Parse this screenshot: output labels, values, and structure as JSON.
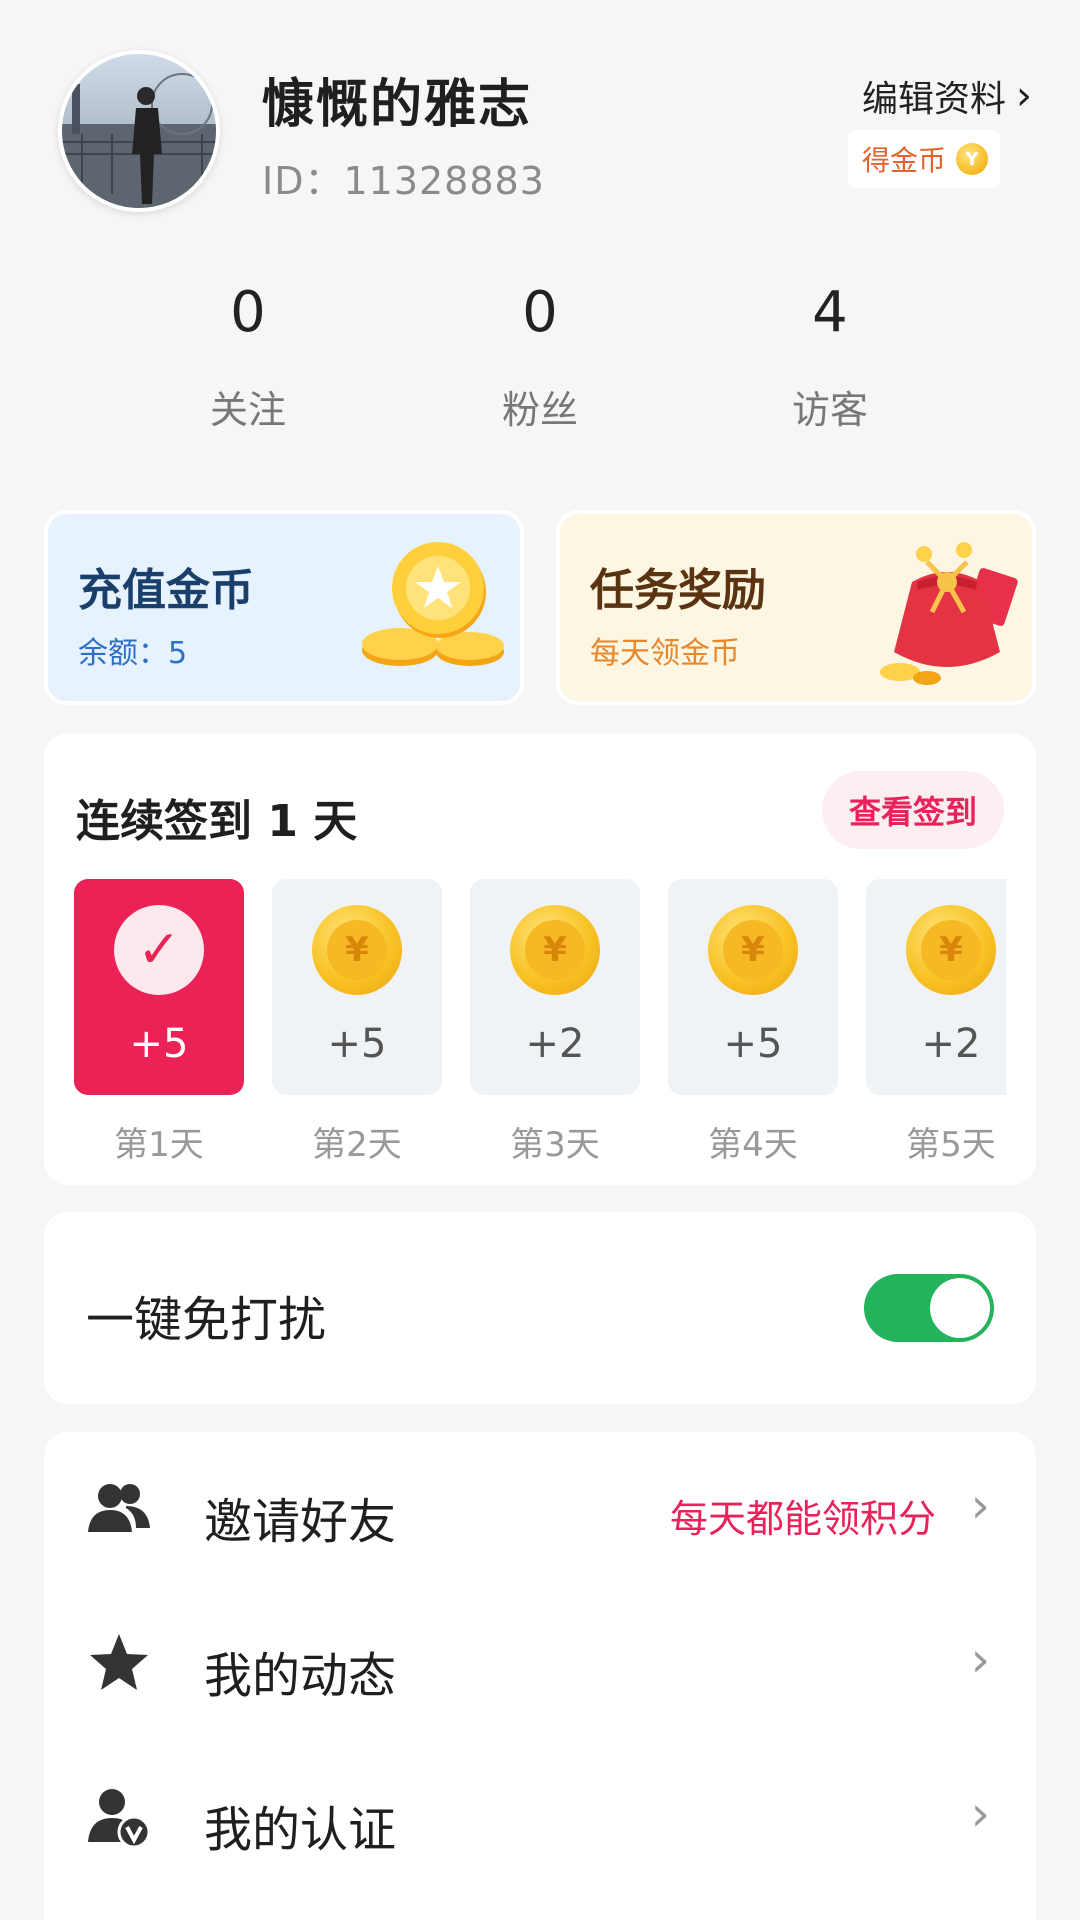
{
  "profile": {
    "name": "慷慨的雅志",
    "id_text": "ID：11328883",
    "edit_label": "编辑资料",
    "coin_badge_label": "得金币",
    "coin_symbol": "Y"
  },
  "stats": [
    {
      "value": "0",
      "label": "关注"
    },
    {
      "value": "0",
      "label": "粉丝"
    },
    {
      "value": "4",
      "label": "访客"
    }
  ],
  "cards": {
    "recharge": {
      "title": "充值金币",
      "subtitle": "余额：5"
    },
    "task": {
      "title": "任务奖励",
      "subtitle": "每天领金币"
    }
  },
  "signin": {
    "title": "连续签到 1 天",
    "button": "查看签到",
    "coin_symbol": "¥",
    "check_symbol": "✓",
    "days": [
      {
        "reward": "+5",
        "label": "第1天",
        "checked": true
      },
      {
        "reward": "+5",
        "label": "第2天",
        "checked": false
      },
      {
        "reward": "+2",
        "label": "第3天",
        "checked": false
      },
      {
        "reward": "+5",
        "label": "第4天",
        "checked": false
      },
      {
        "reward": "+2",
        "label": "第5天",
        "checked": false
      }
    ]
  },
  "dnd": {
    "label": "一键免打扰",
    "enabled": true
  },
  "menu": [
    {
      "label": "邀请好友",
      "extra": "每天都能领积分",
      "icon": "users-icon"
    },
    {
      "label": "我的动态",
      "extra": "",
      "icon": "star-icon"
    },
    {
      "label": "我的认证",
      "extra": "",
      "icon": "verified-user-icon"
    }
  ],
  "colors": {
    "accent": "#ea2256",
    "toggle_on": "#22b35b",
    "recharge_bg": "#e6f3fe",
    "task_bg": "#fdf6e3"
  }
}
